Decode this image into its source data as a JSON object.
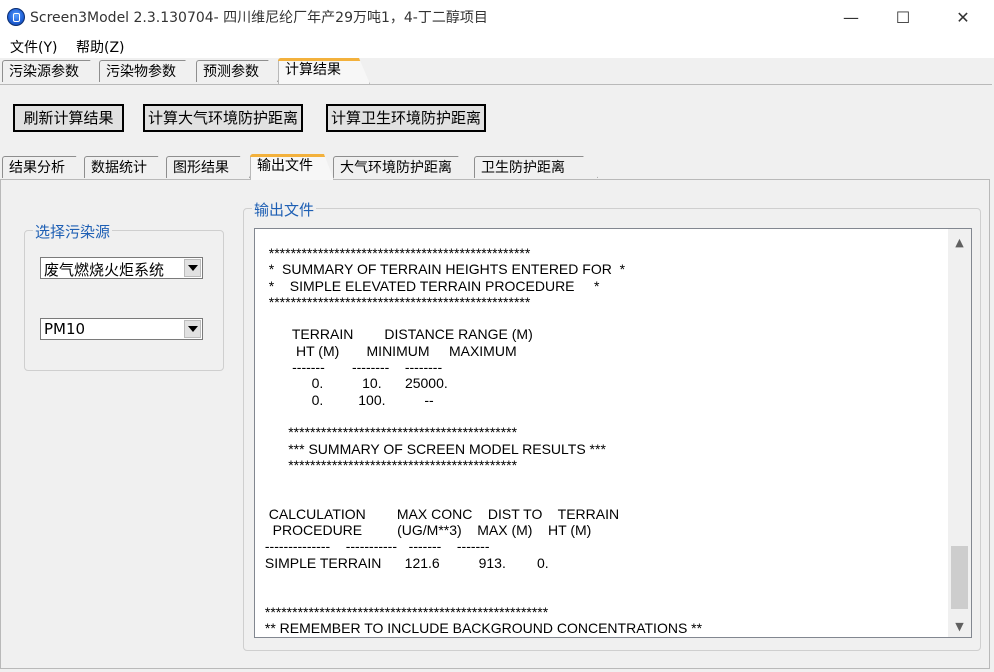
{
  "window": {
    "title": "Screen3Model 2.3.130704- 四川维尼纶厂年产29万吨1，4-丁二醇项目",
    "minimize_glyph": "—",
    "maximize_glyph": "☐",
    "close_glyph": "✕"
  },
  "menu": [
    {
      "label": "文件(Y)"
    },
    {
      "label": "帮助(Z)"
    }
  ],
  "main_tabs": [
    {
      "label": "污染源参数"
    },
    {
      "label": "污染物参数"
    },
    {
      "label": "预测参数"
    },
    {
      "label": "计算结果"
    }
  ],
  "buttons": {
    "refresh": "刷新计算结果",
    "calc_atmos": "计算大气环境防护距离",
    "calc_sanitary": "计算卫生环境防护距离"
  },
  "sub_tabs": [
    {
      "label": "结果分析"
    },
    {
      "label": "数据统计"
    },
    {
      "label": "图形结果"
    },
    {
      "label": "输出文件"
    },
    {
      "label": "大气环境防护距离"
    },
    {
      "label": "卫生防护距离"
    }
  ],
  "source_group": {
    "legend": "选择污染源",
    "source_value": "废气燃烧火炬系统",
    "pollutant_value": "PM10"
  },
  "output_group": {
    "legend": "输出文件",
    "lines": [
      "  ************************************************",
      "  *  SUMMARY OF TERRAIN HEIGHTS ENTERED FOR  *",
      "  *    SIMPLE ELEVATED TERRAIN PROCEDURE     *",
      "  ************************************************",
      "",
      "        TERRAIN        DISTANCE RANGE (M)",
      "         HT (M)       MINIMUM     MAXIMUM",
      "        -------       --------    --------",
      "             0.          10.      25000.",
      "             0.         100.          --",
      "",
      "       ******************************************",
      "       *** SUMMARY OF SCREEN MODEL RESULTS ***",
      "       ******************************************",
      "",
      "",
      "  CALCULATION        MAX CONC    DIST TO    TERRAIN",
      "   PROCEDURE         (UG/M**3)    MAX (M)    HT (M)",
      " --------------    -----------   -------    -------",
      " SIMPLE TERRAIN      121.6          913.        0.",
      "",
      "",
      " ****************************************************",
      " ** REMEMBER TO INCLUDE BACKGROUND CONCENTRATIONS **"
    ]
  },
  "scrollbar": {
    "up_glyph": "▲",
    "down_glyph": "▼"
  }
}
